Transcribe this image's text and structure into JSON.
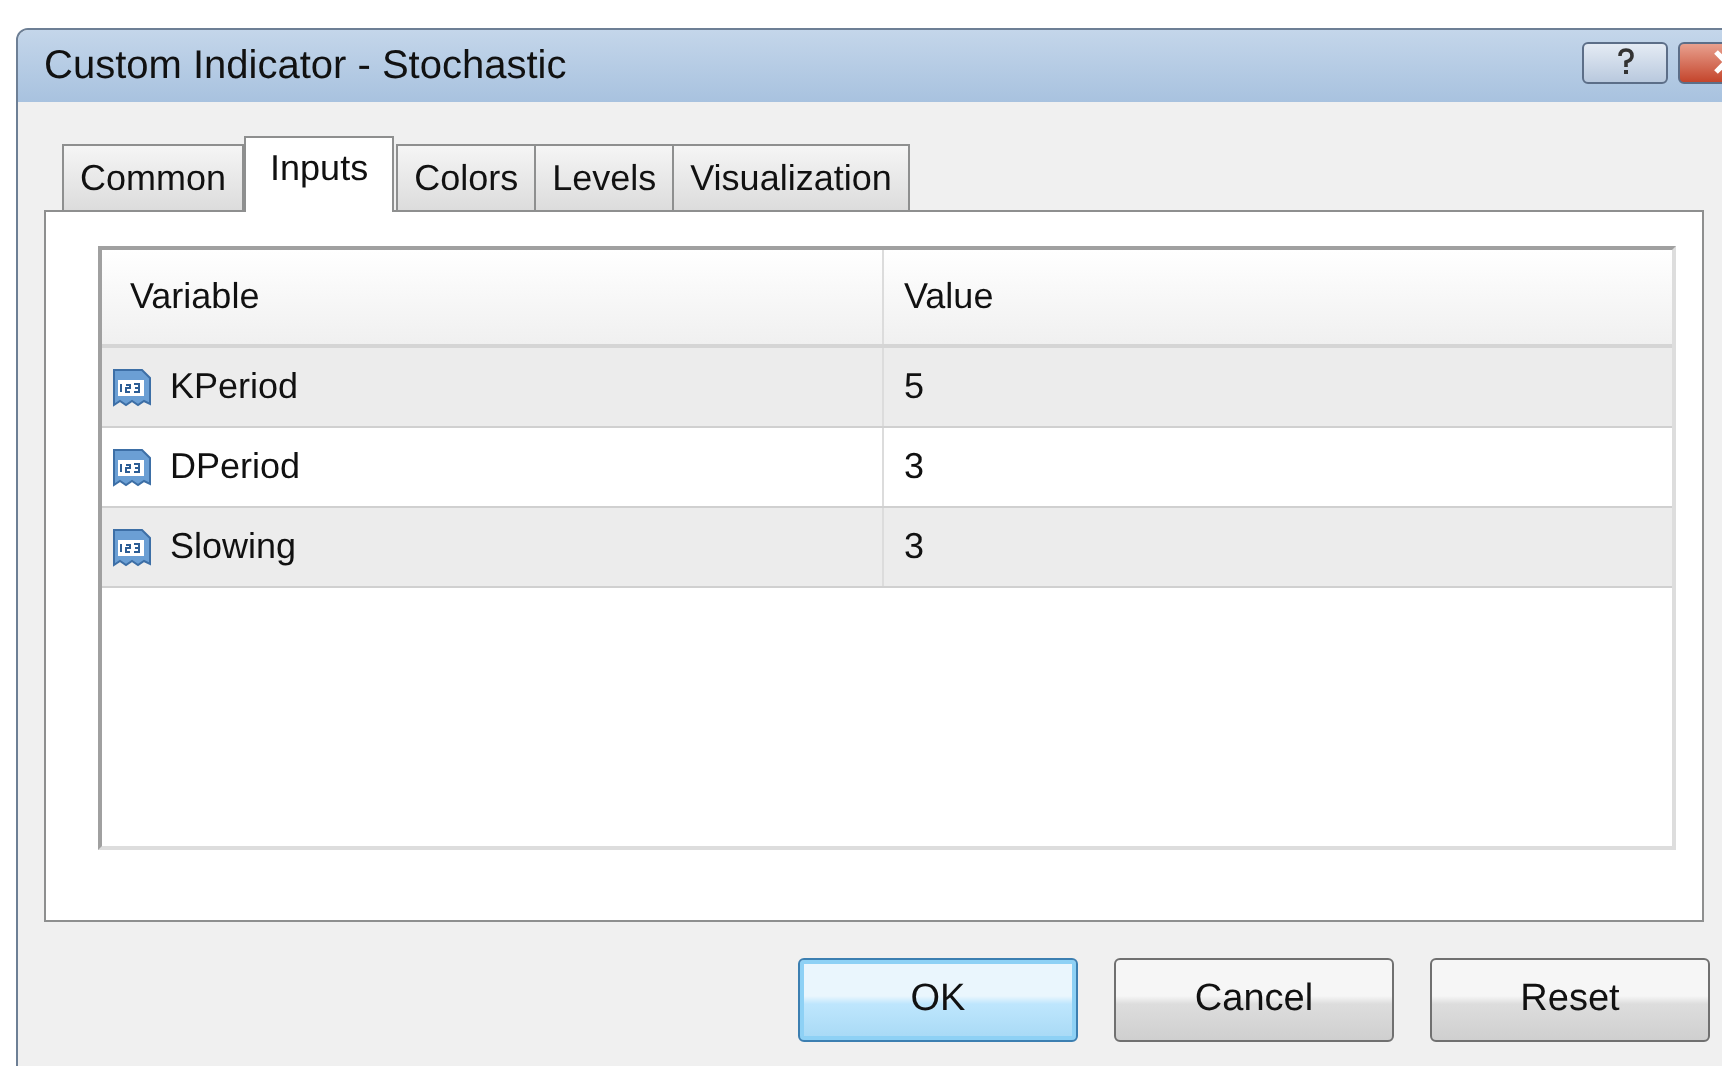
{
  "window": {
    "title": "Custom Indicator - Stochastic"
  },
  "tabs": [
    {
      "label": "Common",
      "selected": false
    },
    {
      "label": "Inputs",
      "selected": true
    },
    {
      "label": "Colors",
      "selected": false
    },
    {
      "label": "Levels",
      "selected": false
    },
    {
      "label": "Visualization",
      "selected": false
    }
  ],
  "table": {
    "columns": [
      "Variable",
      "Value"
    ],
    "rows": [
      {
        "variable": "KPeriod",
        "value": "5"
      },
      {
        "variable": "DPeriod",
        "value": "3"
      },
      {
        "variable": "Slowing",
        "value": "3"
      }
    ]
  },
  "buttons": [
    {
      "label": "OK",
      "default": true
    },
    {
      "label": "Cancel",
      "default": false
    },
    {
      "label": "Reset",
      "default": false
    }
  ]
}
